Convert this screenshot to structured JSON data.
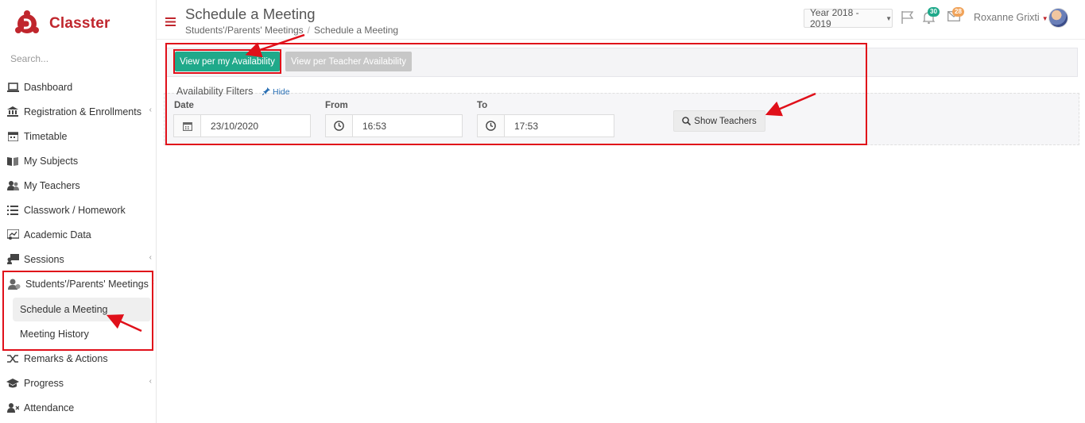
{
  "app": {
    "name": "Classter"
  },
  "sidebar": {
    "search_placeholder": "Search...",
    "items": [
      {
        "label": "Dashboard",
        "icon": "laptop-icon"
      },
      {
        "label": "Registration & Enrollments",
        "icon": "bank-icon"
      },
      {
        "label": "Timetable",
        "icon": "calendar-icon"
      },
      {
        "label": "My Subjects",
        "icon": "book-icon"
      },
      {
        "label": "My Teachers",
        "icon": "users-icon"
      },
      {
        "label": "Classwork / Homework",
        "icon": "list-icon"
      },
      {
        "label": "Academic Data",
        "icon": "chart-icon"
      },
      {
        "label": "Sessions",
        "icon": "sessions-icon"
      },
      {
        "label": "Students'/Parents' Meetings",
        "icon": "meeting-icon"
      },
      {
        "label": "Remarks & Actions",
        "icon": "shuffle-icon"
      },
      {
        "label": "Progress",
        "icon": "graduation-cap-icon"
      },
      {
        "label": "Attendance",
        "icon": "user-x-icon"
      }
    ],
    "submenu": [
      {
        "label": "Schedule a Meeting",
        "active": true
      },
      {
        "label": "Meeting History",
        "active": false
      }
    ]
  },
  "header": {
    "title": "Schedule a Meeting",
    "breadcrumb": [
      "Students'/Parents' Meetings",
      "Schedule a Meeting"
    ],
    "year": "Year 2018 - 2019",
    "notifications_count": "30",
    "messages_count": "28",
    "user_name": "Roxanne Grixti"
  },
  "main": {
    "buttons": {
      "per_my_availability": "View per my Availability",
      "per_teacher_availability": "View per Teacher Availability"
    },
    "filters": {
      "title": "Availability Filters",
      "hide_label": "Hide",
      "date_label": "Date",
      "date_value": "23/10/2020",
      "from_label": "From",
      "from_value": "16:53",
      "to_label": "To",
      "to_value": "17:53",
      "show_teachers_label": "Show Teachers"
    }
  },
  "colors": {
    "brand": "#c0262d",
    "primary_button": "#1fa98a",
    "secondary_button": "#c7c7c7",
    "annotation": "#e0101a"
  }
}
